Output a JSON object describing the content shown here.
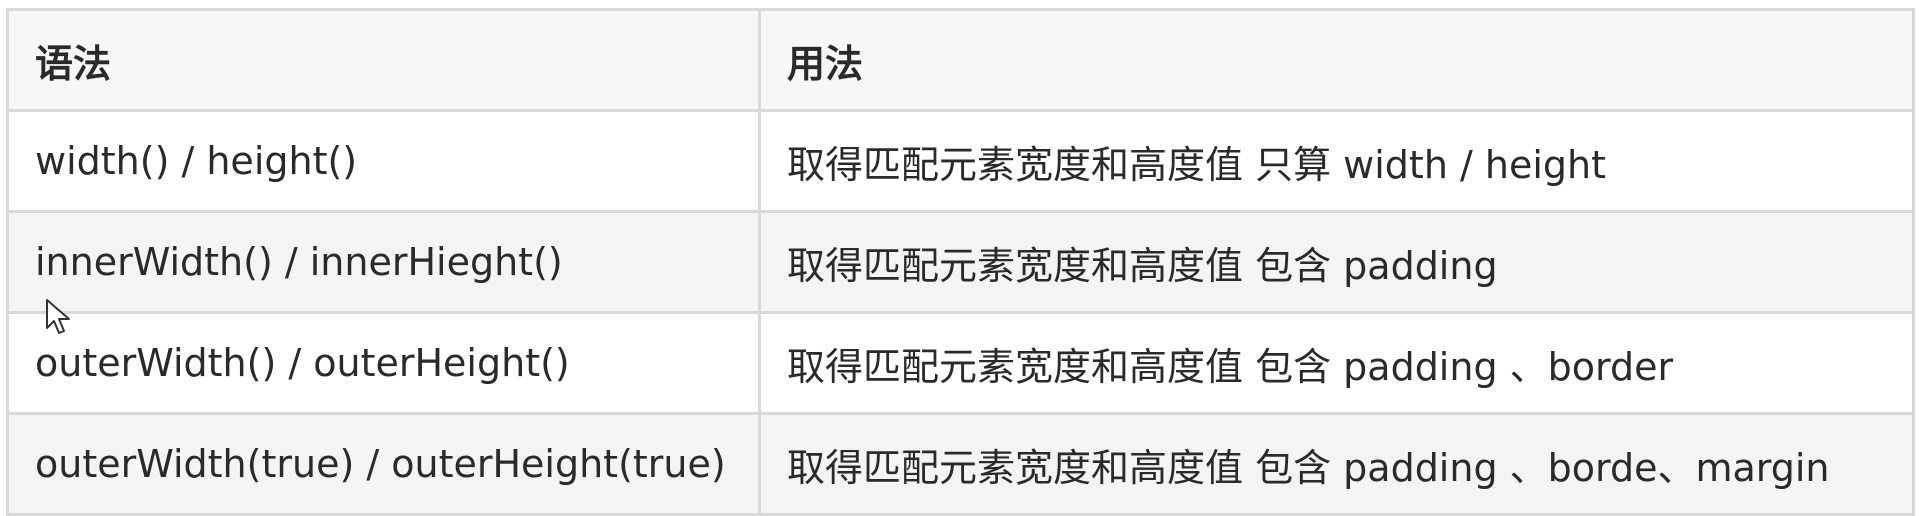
{
  "table": {
    "headers": [
      "语法",
      "用法"
    ],
    "rows": [
      {
        "syntax": "width() / height()",
        "usage": "取得匹配元素宽度和高度值 只算 width / height"
      },
      {
        "syntax": "innerWidth() / innerHieght()",
        "usage": "取得匹配元素宽度和高度值 包含 padding"
      },
      {
        "syntax": "outerWidth() / outerHeight()",
        "usage": "取得匹配元素宽度和高度值 包含 padding 、border"
      },
      {
        "syntax": "outerWidth(true) / outerHeight(true)",
        "usage": "取得匹配元素宽度和高度值 包含 padding 、borde、margin"
      }
    ]
  },
  "colors": {
    "border": "#d9d9d9",
    "header_bg": "#f7f7f7",
    "striped_row_bg": "#f4f4f4",
    "text": "#2a2a2a"
  },
  "icons": {
    "cursor": "mouse-pointer-icon"
  }
}
